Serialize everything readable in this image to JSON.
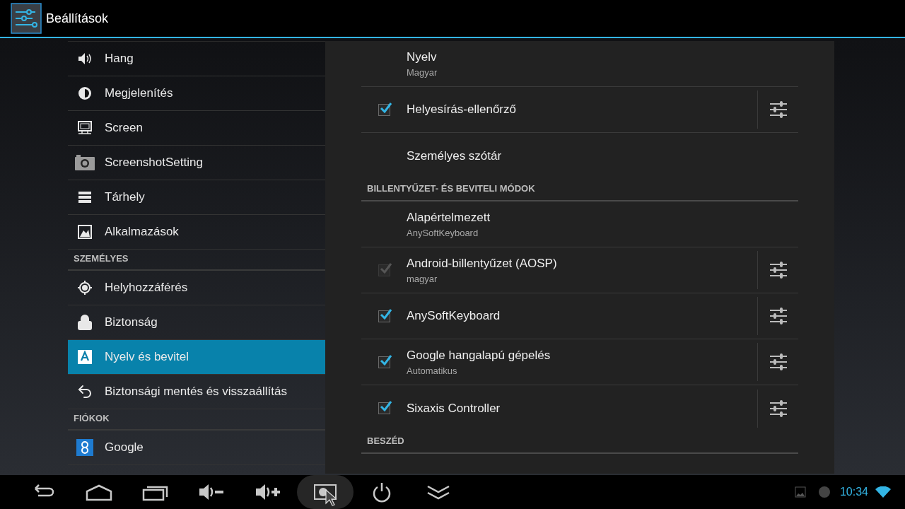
{
  "action_bar": {
    "title": "Beállítások"
  },
  "sidebar": {
    "items": [
      {
        "kind": "item",
        "label": "Hang",
        "selected": false
      },
      {
        "kind": "item",
        "label": "Megjelenítés",
        "selected": false
      },
      {
        "kind": "item",
        "label": "Screen",
        "selected": false
      },
      {
        "kind": "item",
        "label": "ScreenshotSetting",
        "selected": false
      },
      {
        "kind": "item",
        "label": "Tárhely",
        "selected": false
      },
      {
        "kind": "item",
        "label": "Alkalmazások",
        "selected": false
      },
      {
        "kind": "header",
        "label": "SZEMÉLYES"
      },
      {
        "kind": "item",
        "label": "Helyhozzáférés",
        "selected": false
      },
      {
        "kind": "item",
        "label": "Biztonság",
        "selected": false
      },
      {
        "kind": "item",
        "label": "Nyelv és bevitel",
        "selected": true
      },
      {
        "kind": "item",
        "label": "Biztonsági mentés és visszaállítás",
        "selected": false
      },
      {
        "kind": "header",
        "label": "FIÓKOK"
      },
      {
        "kind": "item",
        "label": "Google",
        "selected": false
      }
    ]
  },
  "settings": {
    "rows": [
      {
        "kind": "plain",
        "title": "Nyelv",
        "subtitle": "Magyar"
      },
      {
        "kind": "check",
        "title": "Helyesírás-ellenőrző",
        "checked": true,
        "disabled": false
      },
      {
        "kind": "plain",
        "title": "Személyes szótár"
      },
      {
        "kind": "header",
        "title": "BILLENTYŰZET- ÉS BEVITELI MÓDOK"
      },
      {
        "kind": "plain",
        "title": "Alapértelmezett",
        "subtitle": "AnySoftKeyboard"
      },
      {
        "kind": "check",
        "title": "Android-billentyűzet (AOSP)",
        "subtitle": "magyar",
        "checked": true,
        "disabled": true
      },
      {
        "kind": "check",
        "title": "AnySoftKeyboard",
        "checked": true,
        "disabled": false
      },
      {
        "kind": "check",
        "title": "Google hangalapú gépelés",
        "subtitle": "Automatikus",
        "checked": true,
        "disabled": false
      },
      {
        "kind": "check",
        "title": "Sixaxis Controller",
        "checked": true,
        "disabled": false
      },
      {
        "kind": "header",
        "title": "BESZÉD"
      }
    ]
  },
  "nav_bar": {
    "buttons": [
      {
        "pressed": false
      },
      {
        "pressed": false
      },
      {
        "pressed": false
      },
      {
        "pressed": false
      },
      {
        "pressed": false
      },
      {
        "pressed": true
      },
      {
        "pressed": false
      },
      {
        "pressed": false
      }
    ]
  },
  "status": {
    "clock": "10:34"
  }
}
